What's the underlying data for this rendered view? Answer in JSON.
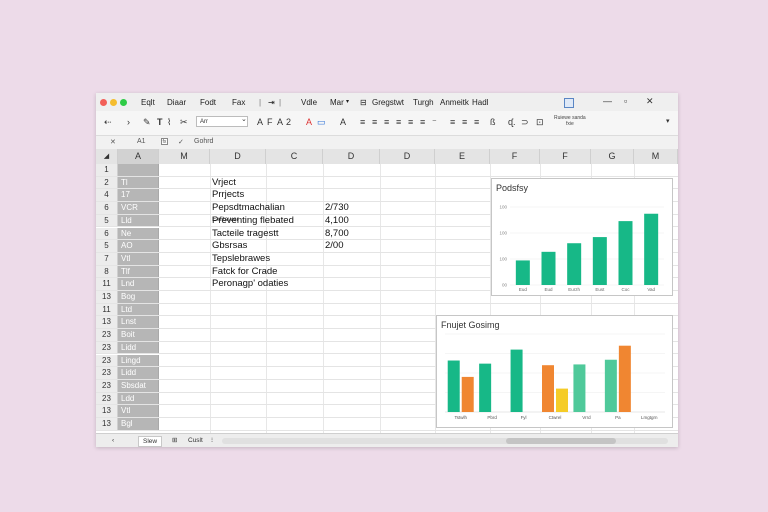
{
  "window": {
    "menu": [
      "Eqlt",
      "Diaar",
      "Fodt",
      "Fax",
      "Vdle",
      "Mar",
      "Gregstwt",
      "Turgh",
      "Anmeitk",
      "Hadl"
    ],
    "ribbon_label": "Ruiewe sanda\nfxie",
    "font_name": "Arr"
  },
  "formula_bar": {
    "cell_ref": "A1",
    "fx_label": "fx",
    "content": "Gohrd"
  },
  "columns": [
    "A",
    "M",
    "D",
    "C",
    "D",
    "D",
    "E",
    "F",
    "F",
    "G",
    "M"
  ],
  "rows": [
    {
      "num": "1",
      "a": "",
      "d": "",
      "v": ""
    },
    {
      "num": "2",
      "a": "Tl",
      "d": "Vrject",
      "v": ""
    },
    {
      "num": "4",
      "a": "17",
      "d": "Prrjects",
      "v": ""
    },
    {
      "num": "6",
      "a": "VCR",
      "d": "Pepsdtmachalian",
      "v": "2/730"
    },
    {
      "num": "5",
      "a": "Lld",
      "d": "Preventing flebated",
      "v": "4,100"
    },
    {
      "num": "6",
      "a": "Ne",
      "d": "Tacteile tragestt",
      "v": "8,700"
    },
    {
      "num": "5",
      "a": "AO",
      "d": "Gbsrsas",
      "v": "2/00"
    },
    {
      "num": "7",
      "a": "Vtl",
      "d": "Tepslebrawes",
      "v": ""
    },
    {
      "num": "8",
      "a": "Tlf",
      "d": "Fatck for Crade",
      "v": ""
    },
    {
      "num": "11",
      "a": "Lnd",
      "d": "Peronagp' odaties",
      "v": ""
    },
    {
      "num": "13",
      "a": "Bog",
      "d": "",
      "v": ""
    },
    {
      "num": "11",
      "a": "Ltd",
      "d": "",
      "v": ""
    },
    {
      "num": "13",
      "a": "Lnst",
      "d": "",
      "v": ""
    },
    {
      "num": "23",
      "a": "Boit",
      "d": "",
      "v": ""
    },
    {
      "num": "23",
      "a": "Lidd",
      "d": "",
      "v": ""
    },
    {
      "num": "23",
      "a": "Lingd",
      "d": "",
      "v": ""
    },
    {
      "num": "23",
      "a": "Lidd",
      "d": "",
      "v": ""
    },
    {
      "num": "23",
      "a": "Sbsdat",
      "d": "",
      "v": ""
    },
    {
      "num": "23",
      "a": "Ldd",
      "d": "",
      "v": ""
    },
    {
      "num": "13",
      "a": "Vtl",
      "d": "",
      "v": ""
    },
    {
      "num": "13",
      "a": "Bgl",
      "d": "",
      "v": ""
    }
  ],
  "row5_note": "Exfitawer",
  "sheet_tabs": [
    "Slew",
    "Cuslt"
  ],
  "chart_data": [
    {
      "type": "bar",
      "title": "Podsfsy",
      "categories": [
        "Eud",
        "Eud",
        "Eurzh",
        "Eust",
        "Coc",
        "Vad"
      ],
      "yticks": [
        "00",
        "100",
        "100",
        "100"
      ],
      "values": [
        0.2,
        0.27,
        0.34,
        0.39,
        0.52,
        0.58
      ],
      "colors": [
        "#17b887",
        "#17b887",
        "#17b887",
        "#17b887",
        "#17b887",
        "#17b887"
      ],
      "ylim": [
        0,
        0.7
      ]
    },
    {
      "type": "bar",
      "title": "Fnujet Gosimg",
      "categories": [
        "Tstwlh",
        "Pbrd",
        "Fyl",
        "Ctwrel",
        "Vrrd",
        "Pa",
        "Lmgtgrn"
      ],
      "series": [
        {
          "values": [
            0.66,
            0.62,
            0.8,
            0.6,
            0.61,
            0.67
          ],
          "colors": [
            "#17b887",
            "#17b887",
            "#17b887",
            "#f08631",
            "#4fc99a",
            "#4fc99a"
          ]
        },
        {
          "values": [
            0.45,
            null,
            null,
            0.3,
            null,
            0.85,
            null
          ],
          "colors": [
            "#f08631",
            "",
            "",
            "#f5cc27",
            "",
            "#f08631",
            ""
          ]
        }
      ],
      "ylim": [
        0,
        1
      ]
    }
  ]
}
